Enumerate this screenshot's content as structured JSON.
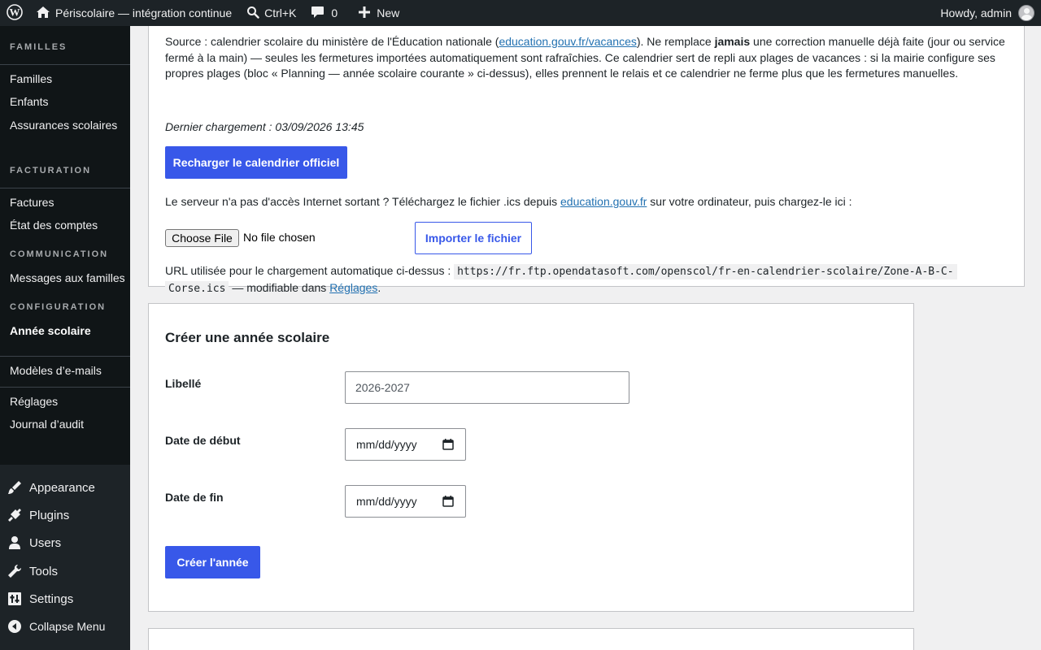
{
  "adminbar": {
    "site_title": "Périscolaire — intégration continue",
    "search_shortcut": "Ctrl+K",
    "comments_count": "0",
    "new_label": "New",
    "howdy": "Howdy, admin",
    "icons": [
      "wordpress-icon",
      "home-icon",
      "search-icon",
      "comment-icon",
      "plus-icon",
      "avatar"
    ]
  },
  "sidebar": {
    "sections": [
      {
        "title": "FAMILLES",
        "items": [
          "Familles",
          "Enfants",
          "Assurances scolaires"
        ]
      },
      {
        "title": "FACTURATION",
        "items": [
          "Factures",
          "État des comptes"
        ]
      },
      {
        "title": "COMMUNICATION",
        "items": [
          "Messages aux familles"
        ]
      },
      {
        "title": "CONFIGURATION",
        "items": [
          "Année scolaire"
        ]
      }
    ],
    "extra_items": [
      "Modèles d’e-mails",
      "Réglages",
      "Journal d’audit"
    ],
    "current": "Année scolaire",
    "menu": [
      {
        "label": "Appearance",
        "icon": "appearance-icon"
      },
      {
        "label": "Plugins",
        "icon": "plugins-icon"
      },
      {
        "label": "Users",
        "icon": "users-icon"
      },
      {
        "label": "Tools",
        "icon": "tools-icon"
      },
      {
        "label": "Settings",
        "icon": "settings-icon"
      },
      {
        "label": "Collapse Menu",
        "icon": "collapse-icon"
      }
    ]
  },
  "calendar_card": {
    "intro_pre": "Source : calendrier scolaire du ministère de l'Éducation nationale (",
    "intro_link": "education.gouv.fr/vacances",
    "intro_mid": "). Ne remplace ",
    "intro_bold": "jamais",
    "intro_post_line1": " une correction manuelle déjà faite (jour ou service",
    "intro_line2": "fermé à la main) — seules les fermetures importées automatiquement sont rafraîchies. Ce calendrier sert de repli aux plages de vacances : si la mairie configure ses",
    "intro_line3": "propres plages (bloc « Planning — année scolaire courante » ci-dessus), elles prennent le relais et ce calendrier ne ferme plus que les fermetures manuelles.",
    "last_load": "Dernier chargement : 03/09/2026 13:45",
    "reload_button": "Recharger le calendrier officiel",
    "offline_pre": "Le serveur n'a pas d'accès Internet sortant ? Téléchargez le fichier .ics depuis ",
    "offline_link": "education.gouv.fr",
    "offline_post": " sur votre ordinateur, puis chargez-le ici :",
    "choose_file": "Choose File",
    "no_file": "No file chosen",
    "import_button": "Importer le fichier",
    "url_pre": "URL utilisée pour le chargement automatique ci-dessus : ",
    "url_line1": "https://fr.ftp.opendatasoft.com/openscol/fr-en-calendrier-scolaire/Zone-A-B-C-",
    "url_line2": "Corse.ics",
    "url_post": " — modifiable dans ",
    "url_settings_link": "Réglages",
    "url_end": "."
  },
  "create_year_card": {
    "title": "Créer une année scolaire",
    "label_field": "Libellé",
    "label_placeholder": "2026-2027",
    "start_label": "Date de début",
    "start_value": "mm/dd/yyyy",
    "end_label": "Date de fin",
    "end_value": "mm/dd/yyyy",
    "submit": "Créer l'année"
  }
}
